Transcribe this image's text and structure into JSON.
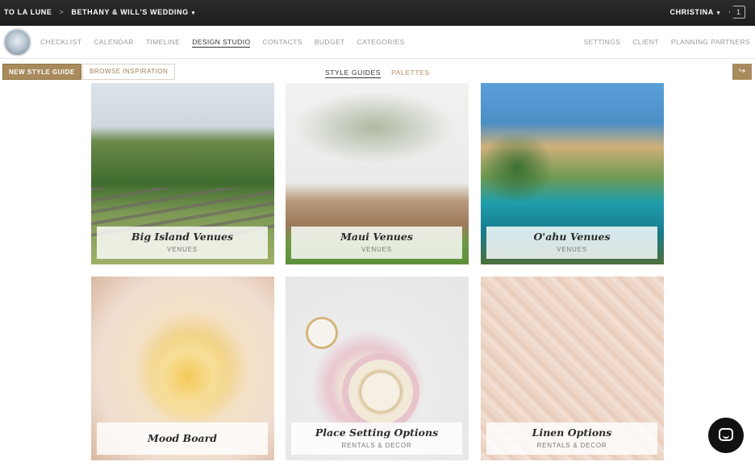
{
  "topbar": {
    "brand": "TO LA LUNE",
    "separator": ">",
    "project": "BETHANY & WILL'S WEDDING",
    "user": "CHRISTINA",
    "notifications": "1",
    "caret": "▾"
  },
  "nav": {
    "items": [
      {
        "label": "CHECKLIST"
      },
      {
        "label": "CALENDAR"
      },
      {
        "label": "TIMELINE"
      },
      {
        "label": "DESIGN STUDIO",
        "active": true
      },
      {
        "label": "CONTACTS"
      },
      {
        "label": "BUDGET"
      },
      {
        "label": "CATEGORIES"
      }
    ],
    "right": [
      {
        "label": "SETTINGS"
      },
      {
        "label": "CLIENT"
      },
      {
        "label": "PLANNING PARTNERS"
      }
    ]
  },
  "toolbar": {
    "new_style_guide": "NEW STYLE GUIDE",
    "browse_inspiration": "BROWSE INSPIRATION",
    "tab_style_guides": "STYLE GUIDES",
    "tab_palettes": "PALETTES",
    "share_icon": "share-icon"
  },
  "cards": [
    {
      "title": "Big Island Venues",
      "category": "VENUES",
      "image": "outdoor-ceremony-benches"
    },
    {
      "title": "Maui Venues",
      "category": "VENUES",
      "image": "tree-ceremony-site"
    },
    {
      "title": "O'ahu Venues",
      "category": "VENUES",
      "image": "resort-pool"
    },
    {
      "title": "Mood Board",
      "category": "",
      "image": "bridal-bouquet"
    },
    {
      "title": "Place Setting Options",
      "category": "RENTALS & DECOR",
      "image": "table-setting"
    },
    {
      "title": "Linen Options",
      "category": "RENTALS & DECOR",
      "image": "sequin-linen"
    }
  ],
  "colors": {
    "accent": "#a88a5c",
    "topbar": "#222222",
    "muted_text": "#999999"
  },
  "chat": {
    "icon": "chat-bubble-icon"
  }
}
